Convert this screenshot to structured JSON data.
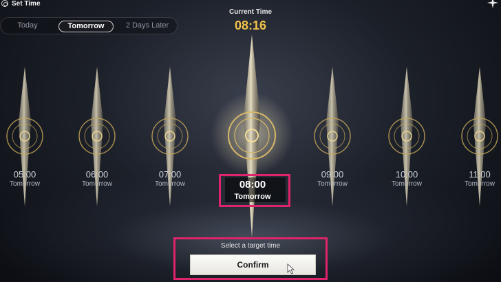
{
  "header": {
    "title": "Set Time"
  },
  "day_tabs": [
    {
      "label": "Today",
      "active": false
    },
    {
      "label": "Tomorrow",
      "active": true
    },
    {
      "label": "2 Days Later",
      "active": false
    }
  ],
  "current": {
    "label": "Current Time",
    "value": "08:16"
  },
  "time_slots": [
    {
      "time": "05:00",
      "day": "Tomorrow",
      "selected": false
    },
    {
      "time": "06:00",
      "day": "Tomorrow",
      "selected": false
    },
    {
      "time": "07:00",
      "day": "Tomorrow",
      "selected": false
    },
    {
      "time": "08:00",
      "day": "Tomorrow",
      "selected": true
    },
    {
      "time": "09:00",
      "day": "Tomorrow",
      "selected": false
    },
    {
      "time": "10:00",
      "day": "Tomorrow",
      "selected": false
    },
    {
      "time": "11:00",
      "day": "Tomorrow",
      "selected": false
    }
  ],
  "footer": {
    "prompt": "Select a target time",
    "confirm_label": "Confirm"
  },
  "colors": {
    "accent_time": "#f2c34a",
    "highlight": "#e0246b",
    "crystal": "#d8cfb4",
    "dial_gold": "#c8a85a"
  }
}
